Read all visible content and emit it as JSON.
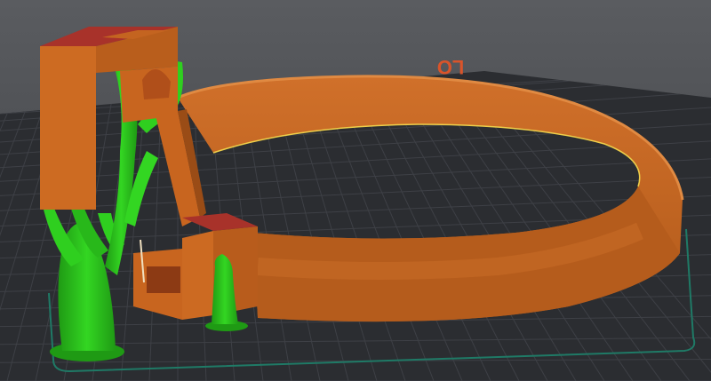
{
  "viewport": {
    "bed_label": "LO",
    "colors": {
      "background_top": "#5a5c60",
      "background_bottom": "#3c3e42",
      "bed": "#2a2c30",
      "grid_line": "#3e4046",
      "bed_edge": "#1f7a66",
      "model": "#c8651f",
      "model_dark": "#9a4c16",
      "model_top": "#a8322a",
      "support": "#2fcf1f",
      "support_dark": "#1f9a14",
      "bed_label": "#d9542a"
    }
  }
}
